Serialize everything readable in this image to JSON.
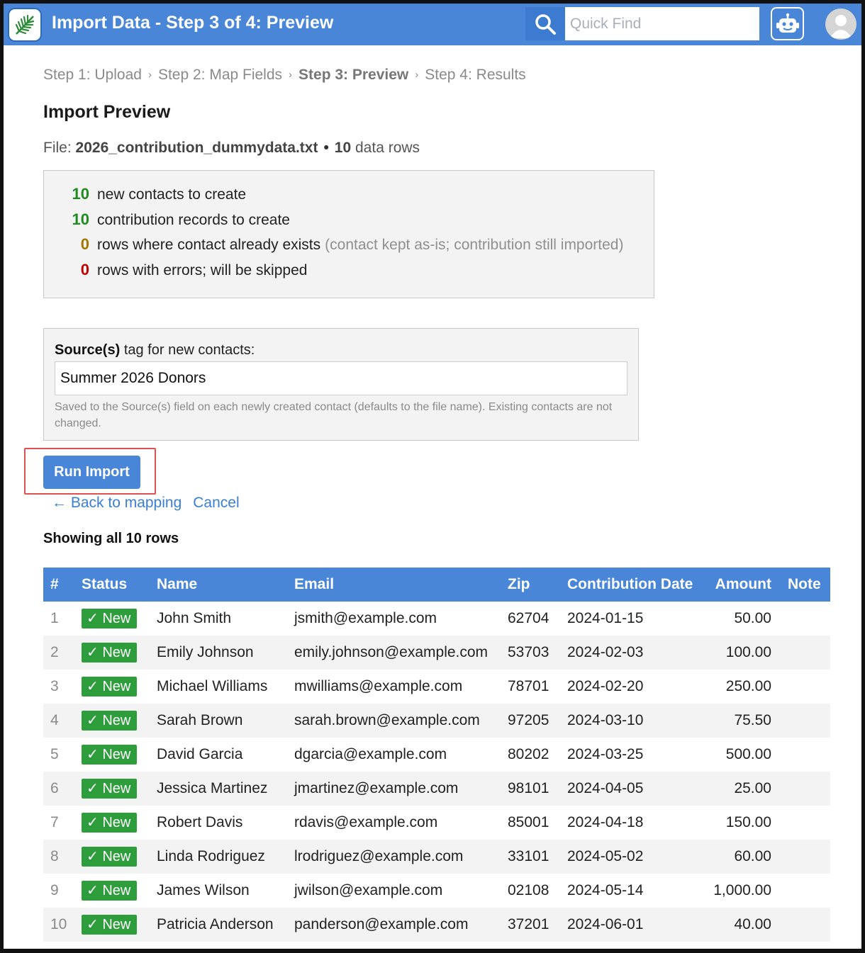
{
  "header": {
    "title": "Import Data - Step 3 of 4: Preview",
    "search_placeholder": "Quick Find",
    "icons": {
      "logo": "fern-logo-icon",
      "search": "search-icon",
      "bot": "robot-icon",
      "avatar": "user-avatar-icon"
    }
  },
  "breadcrumb": {
    "steps": [
      "Step 1: Upload",
      "Step 2: Map Fields",
      "Step 3: Preview",
      "Step 4: Results"
    ],
    "separator": "›",
    "current_index": 2
  },
  "page": {
    "title": "Import Preview",
    "file_label": "File:",
    "file_name": "2026_contribution_dummydata.txt",
    "bullet": "•",
    "row_count": "10",
    "row_suffix": "data rows"
  },
  "summary": [
    {
      "count": "10",
      "text": "new contacts to create",
      "note": "",
      "color": "#1f8a1f"
    },
    {
      "count": "10",
      "text": "contribution records to create",
      "note": "",
      "color": "#1f8a1f"
    },
    {
      "count": "0",
      "text": "rows where contact already exists",
      "note": "(contact kept as-is; contribution still imported)",
      "color": "#a07800"
    },
    {
      "count": "0",
      "text": "rows with errors; will be skipped",
      "note": "",
      "color": "#c00000"
    }
  ],
  "source": {
    "label_bold": "Source(s)",
    "label_rest": "tag for new contacts:",
    "value": "Summer 2026 Donors",
    "help": "Saved to the Source(s) field on each newly created contact (defaults to the file name). Existing contacts are not changed."
  },
  "actions": {
    "run_label": "Run Import",
    "back_label": "← Back to mapping",
    "cancel_label": "Cancel"
  },
  "table": {
    "caption": "Showing all 10 rows",
    "columns": [
      "#",
      "Status",
      "Name",
      "Email",
      "Zip",
      "Contribution Date",
      "Amount",
      "Note"
    ],
    "rows": [
      {
        "n": "1",
        "status": "✓ New",
        "name": "John Smith",
        "email": "jsmith@example.com",
        "zip": "62704",
        "date": "2024-01-15",
        "amount": "50.00",
        "note": ""
      },
      {
        "n": "2",
        "status": "✓ New",
        "name": "Emily Johnson",
        "email": "emily.johnson@example.com",
        "zip": "53703",
        "date": "2024-02-03",
        "amount": "100.00",
        "note": ""
      },
      {
        "n": "3",
        "status": "✓ New",
        "name": "Michael Williams",
        "email": "mwilliams@example.com",
        "zip": "78701",
        "date": "2024-02-20",
        "amount": "250.00",
        "note": ""
      },
      {
        "n": "4",
        "status": "✓ New",
        "name": "Sarah Brown",
        "email": "sarah.brown@example.com",
        "zip": "97205",
        "date": "2024-03-10",
        "amount": "75.50",
        "note": ""
      },
      {
        "n": "5",
        "status": "✓ New",
        "name": "David Garcia",
        "email": "dgarcia@example.com",
        "zip": "80202",
        "date": "2024-03-25",
        "amount": "500.00",
        "note": ""
      },
      {
        "n": "6",
        "status": "✓ New",
        "name": "Jessica Martinez",
        "email": "jmartinez@example.com",
        "zip": "98101",
        "date": "2024-04-05",
        "amount": "25.00",
        "note": ""
      },
      {
        "n": "7",
        "status": "✓ New",
        "name": "Robert Davis",
        "email": "rdavis@example.com",
        "zip": "85001",
        "date": "2024-04-18",
        "amount": "150.00",
        "note": ""
      },
      {
        "n": "8",
        "status": "✓ New",
        "name": "Linda Rodriguez",
        "email": "lrodriguez@example.com",
        "zip": "33101",
        "date": "2024-05-02",
        "amount": "60.00",
        "note": ""
      },
      {
        "n": "9",
        "status": "✓ New",
        "name": "James Wilson",
        "email": "jwilson@example.com",
        "zip": "02108",
        "date": "2024-05-14",
        "amount": "1,000.00",
        "note": ""
      },
      {
        "n": "10",
        "status": "✓ New",
        "name": "Patricia Anderson",
        "email": "panderson@example.com",
        "zip": "37201",
        "date": "2024-06-01",
        "amount": "40.00",
        "note": ""
      }
    ]
  },
  "colors": {
    "brand": "#4a86d8",
    "link": "#3a7fd5",
    "new_badge": "#2e9e3c",
    "highlight": "#e05050"
  }
}
